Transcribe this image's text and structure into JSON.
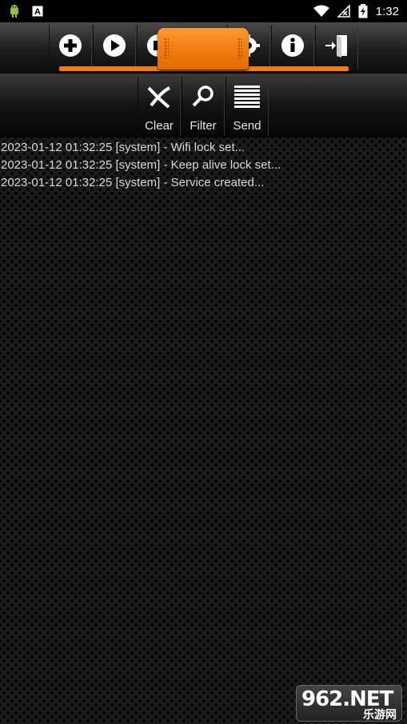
{
  "status_bar": {
    "time": "1:32",
    "icons": [
      "android-robot-icon",
      "a-icon",
      "wifi-icon",
      "no-signal-icon",
      "battery-charging-icon"
    ]
  },
  "toolbar": {
    "buttons": [
      "add-icon",
      "play-icon",
      "stop-icon",
      "gear-icon",
      "info-icon",
      "exit-icon"
    ],
    "accent_color": "#f07c12"
  },
  "subtoolbar": {
    "clear_label": "Clear",
    "filter_label": "Filter",
    "send_label": "Send"
  },
  "log": {
    "lines": [
      "2023-01-12 01:32:25 [system] - Wifi lock set...",
      "2023-01-12 01:32:25 [system] - Keep alive lock set...",
      "2023-01-12 01:32:25 [system] - Service created..."
    ]
  },
  "watermark": {
    "top": "962.NET",
    "bottom": "乐游网"
  }
}
